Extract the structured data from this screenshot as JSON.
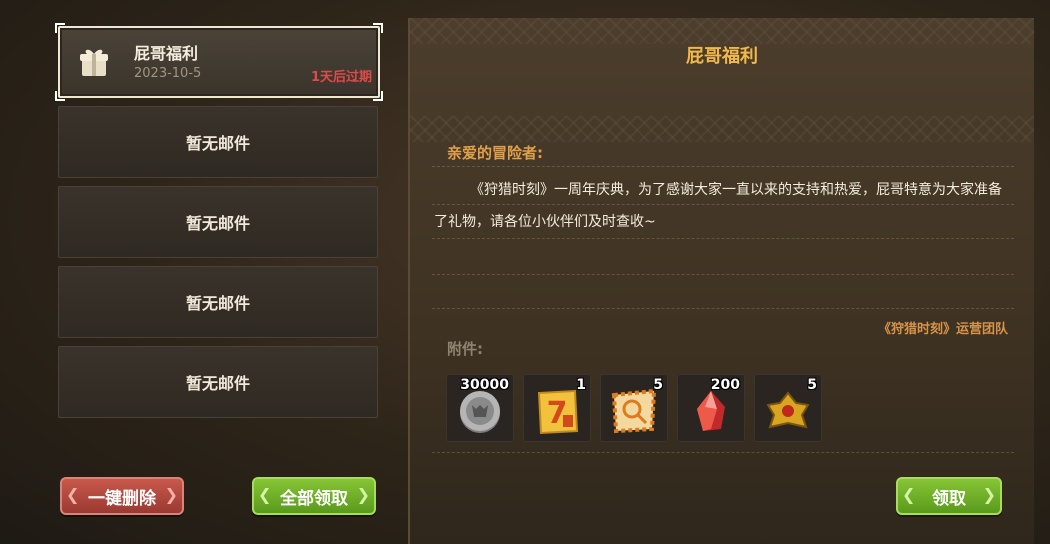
{
  "mail_list": {
    "selected": {
      "title": "屁哥福利",
      "date": "2023-10-5",
      "expire": "1天后过期"
    },
    "empty_label": "暂无邮件",
    "empty_slots": 4
  },
  "buttons": {
    "delete_all": "一键删除",
    "claim_all": "全部领取",
    "claim": "领取"
  },
  "detail": {
    "title": "屁哥福利",
    "greeting": "亲爱的冒险者:",
    "body": "《狩猎时刻》一周年庆典，为了感谢大家一直以来的支持和热爱，屁哥特意为大家准备了礼物，请各位小伙伴们及时查收~",
    "signature": "《狩猎时刻》运营团队",
    "attachments_label": "附件:",
    "attachments": [
      {
        "icon": "silver-coin-icon",
        "count": "30000"
      },
      {
        "icon": "discount-coupon-icon",
        "count": "1"
      },
      {
        "icon": "treasure-map-icon",
        "count": "5"
      },
      {
        "icon": "red-crystal-icon",
        "count": "200"
      },
      {
        "icon": "gold-crest-icon",
        "count": "5"
      }
    ]
  },
  "colors": {
    "accent_gold": "#f0b94a",
    "expire_red": "#e04a4a",
    "button_green": "#6fb32a",
    "button_red": "#b5483e"
  }
}
